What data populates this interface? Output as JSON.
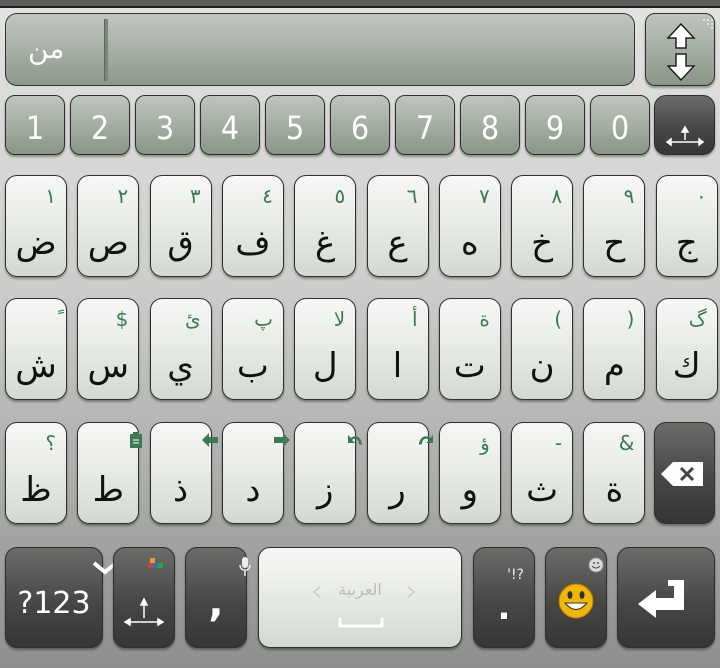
{
  "suggestion_bar": {
    "word": "من"
  },
  "number_row": [
    "1",
    "2",
    "3",
    "4",
    "5",
    "6",
    "7",
    "8",
    "9",
    "0"
  ],
  "rows": [
    [
      {
        "main": "ض",
        "hint": "١"
      },
      {
        "main": "ص",
        "hint": "٢"
      },
      {
        "main": "ق",
        "hint": "٣"
      },
      {
        "main": "ف",
        "hint": "٤"
      },
      {
        "main": "غ",
        "hint": "٥"
      },
      {
        "main": "ع",
        "hint": "٦"
      },
      {
        "main": "ه",
        "hint": "٧"
      },
      {
        "main": "خ",
        "hint": "٨"
      },
      {
        "main": "ح",
        "hint": "٩"
      },
      {
        "main": "ج",
        "hint": "٠"
      }
    ],
    [
      {
        "main": "ش",
        "hint": "ًَ"
      },
      {
        "main": "س",
        "hint": "$"
      },
      {
        "main": "ي",
        "hint": "ئ"
      },
      {
        "main": "ب",
        "hint": "پ"
      },
      {
        "main": "ل",
        "hint": "لا"
      },
      {
        "main": "ا",
        "hint": "أ"
      },
      {
        "main": "ت",
        "hint": "ة"
      },
      {
        "main": "ن",
        "hint": "("
      },
      {
        "main": "م",
        "hint": ")"
      },
      {
        "main": "ك",
        "hint": "گ"
      }
    ],
    [
      {
        "main": "ظ",
        "hint": "؟"
      },
      {
        "main": "ط",
        "hint": "clipboard-icon"
      },
      {
        "main": "ذ",
        "hint": "arrow-left-icon"
      },
      {
        "main": "د",
        "hint": "arrow-right-icon"
      },
      {
        "main": "ز",
        "hint": "undo-icon"
      },
      {
        "main": "ر",
        "hint": "redo-icon"
      },
      {
        "main": "و",
        "hint": "ؤ"
      },
      {
        "main": "ث",
        "hint": "-"
      },
      {
        "main": "ة",
        "hint": "&"
      }
    ]
  ],
  "bottom_row": {
    "symbols_label": "?123",
    "comma": ",",
    "space_language": "العربية",
    "period": ".",
    "period_hint": "'!?"
  },
  "icons": {
    "shift": "up-down-arrows-icon",
    "cursor": "cursor-move-icon",
    "delete": "backspace-icon",
    "mic": "microphone-icon",
    "emoji": "smiley-icon",
    "enter": "enter-icon",
    "chevron": "chevron-down-icon"
  },
  "colors": {
    "hint": "#3c7a55",
    "key_light": "#e3e7e2",
    "key_dark": "#474846",
    "suggest_bar": "#a3aca2"
  }
}
